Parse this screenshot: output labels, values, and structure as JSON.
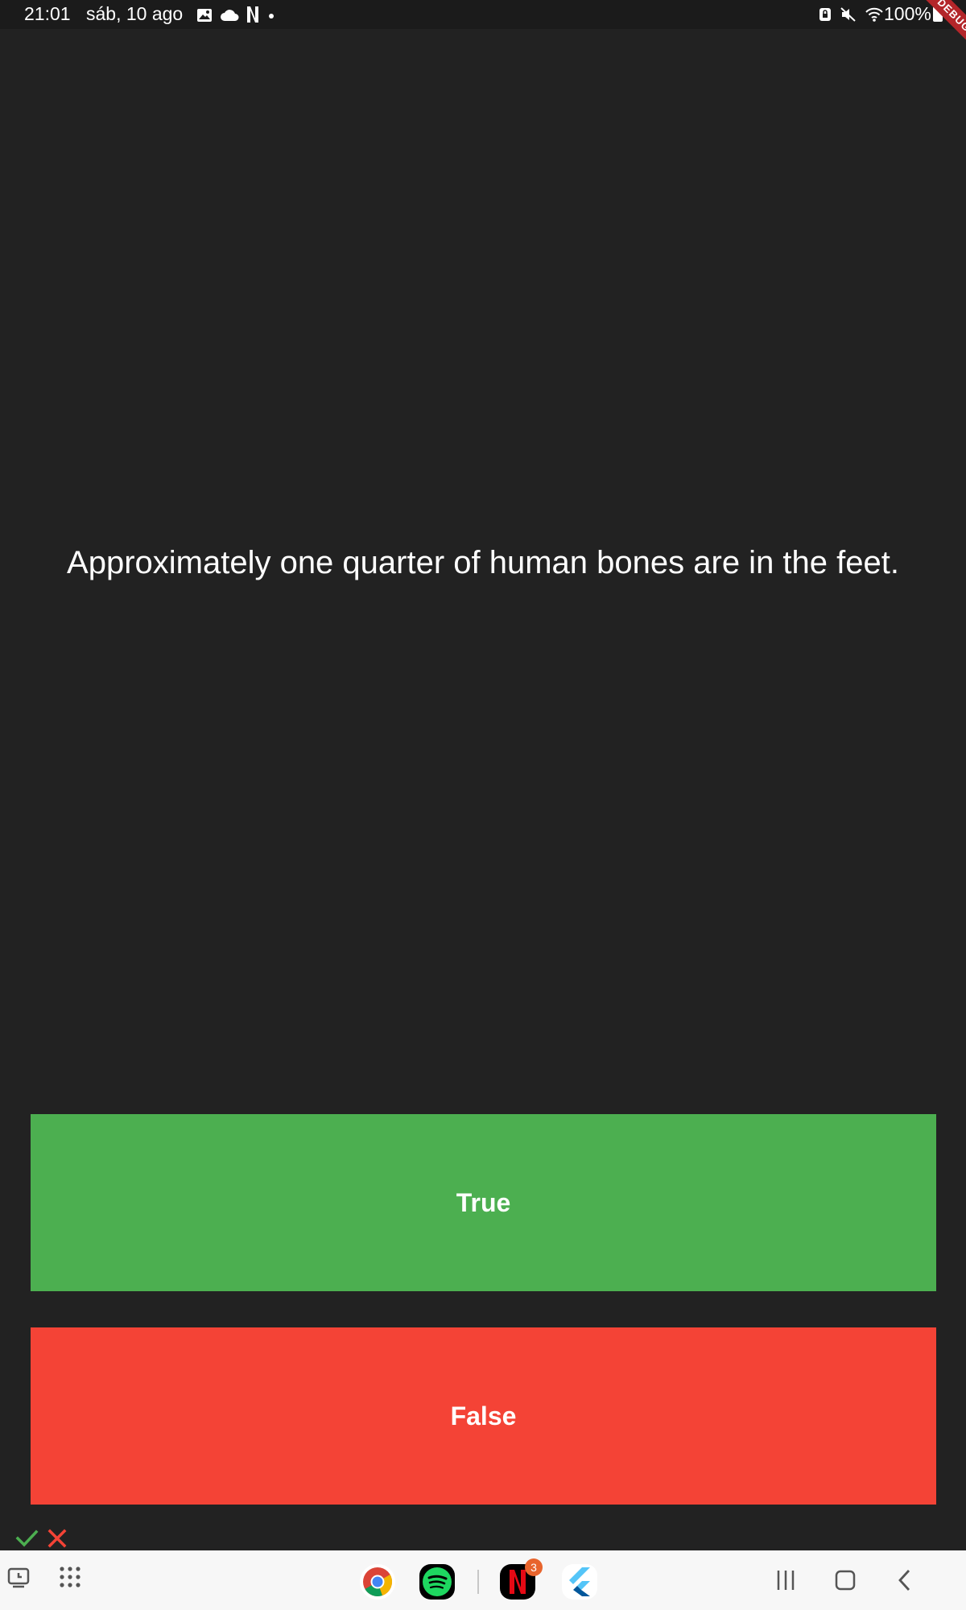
{
  "status_bar": {
    "time": "21:01",
    "date": "sáb, 10 ago",
    "battery": "100%",
    "left_icons": [
      "gallery-icon",
      "cloud-icon",
      "netflix-notification-icon",
      "dot-icon"
    ],
    "right_icons": [
      "lock-rotation-icon",
      "mute-icon",
      "wifi-icon",
      "battery-icon"
    ]
  },
  "debug_banner": "DEBUG",
  "quiz": {
    "question": "Approximately one quarter of human bones are in the feet.",
    "true_label": "True",
    "false_label": "False",
    "true_color": "#4caf50",
    "false_color": "#f44336",
    "score_icons": [
      "check-icon",
      "close-icon"
    ]
  },
  "nav_bar": {
    "left_icons": [
      "recent-apps-icon",
      "app-drawer-icon"
    ],
    "dock_apps": [
      {
        "icon": "chrome-icon"
      },
      {
        "icon": "spotify-icon"
      },
      {
        "icon": "netflix-icon",
        "badge": "3"
      },
      {
        "icon": "flutter-icon"
      }
    ],
    "system_buttons": [
      "recents-button",
      "home-button",
      "back-button"
    ]
  },
  "colors": {
    "background": "#222222",
    "text": "#ffffff",
    "check": "#4caf50",
    "cross": "#f44336"
  }
}
